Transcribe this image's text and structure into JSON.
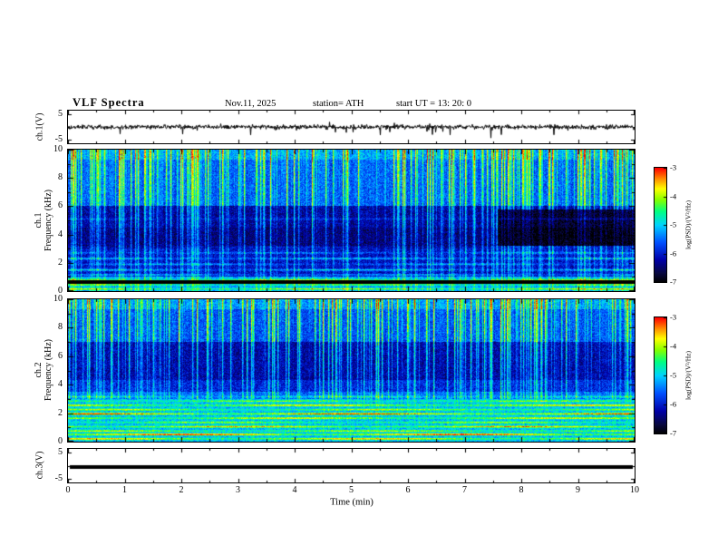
{
  "header": {
    "title": "VLF  Spectra",
    "date": "Nov.11, 2025",
    "station": "station= ATH",
    "start_ut": "start UT  =   13: 20: 0"
  },
  "axes": {
    "time_title": "Time  (min)",
    "time_ticks": [
      0,
      1,
      2,
      3,
      4,
      5,
      6,
      7,
      8,
      9,
      10
    ],
    "ch1v": {
      "label": "ch.1(V)",
      "ticks": [
        5,
        -5
      ]
    },
    "ch3v": {
      "label": "ch.3(V)",
      "ticks": [
        5,
        -5
      ]
    },
    "ch1f": {
      "line1": "ch.1",
      "line2": "Frequency  (kHz)",
      "ticks": [
        10,
        8,
        6,
        4,
        2,
        0
      ]
    },
    "ch2f": {
      "line1": "ch.2",
      "line2": "Frequency  (kHz)",
      "ticks": [
        10,
        8,
        6,
        4,
        2,
        0
      ]
    }
  },
  "colorbar": {
    "title": "log(PSD)/(V²/Hz)",
    "ticks": [
      -3,
      -4,
      -5,
      -6,
      -7
    ],
    "min": -7,
    "max": -3
  },
  "colors": {
    "background": "#ffffff",
    "axis": "#000000",
    "trace": "#000000",
    "colormap_stops": [
      [
        0.0,
        "#000000"
      ],
      [
        0.08,
        "#08083f"
      ],
      [
        0.2,
        "#0000aa"
      ],
      [
        0.35,
        "#0050ff"
      ],
      [
        0.5,
        "#00d2ff"
      ],
      [
        0.62,
        "#00ff82"
      ],
      [
        0.72,
        "#82ff00"
      ],
      [
        0.82,
        "#ffff00"
      ],
      [
        0.9,
        "#ff9600"
      ],
      [
        1.0,
        "#ff0000"
      ]
    ]
  },
  "chart_data": [
    {
      "type": "line",
      "name": "ch1-voltage-waveform",
      "panel": "p1",
      "ylabel": "ch.1(V)",
      "ylim": [
        -5,
        5
      ],
      "yticks": [
        5,
        -5
      ],
      "x_range_min": [
        0,
        10
      ],
      "description": "Channel 1 VLF receiver voltage vs time: broadband noise around 0 V (about +/-1.5 V) with frequent impulsive sferic spikes reaching about -5 V",
      "noise_sigma": 0.55,
      "spike_rate": 0.025,
      "seed": 101
    },
    {
      "type": "heatmap",
      "name": "ch1-spectrogram",
      "panel": "p2",
      "x_range_min": [
        0,
        10
      ],
      "y_range_khz": [
        0,
        10
      ],
      "value_range_log_psd": [
        -7,
        -3
      ],
      "description": "Channel 1 VLF spectrogram: dense vertical sferic streaks 0-10 kHz, bright yellow-green band above ~6 kHz, dark blue quiet band 3-6 kHz, horizontal interference lines below 3 kHz, black band near 0.5-0.8 kHz; the 3.2-5.8 kHz band darkens after ~7.6 min",
      "seed": 202,
      "noise": 0.75,
      "streak_rate": 0.27,
      "streak_max": 2.4,
      "streak_floor": 0.32,
      "bands": [
        {
          "lo": 9.3,
          "hi": 10.01,
          "level": -5.35
        },
        {
          "lo": 6.0,
          "hi": 9.3,
          "level": -5.65
        },
        {
          "lo": 4.5,
          "hi": 6.0,
          "level": -6.35
        },
        {
          "lo": 3.0,
          "hi": 4.5,
          "level": -6.5
        },
        {
          "lo": 1.0,
          "hi": 3.0,
          "level": -6.15
        },
        {
          "lo": -0.1,
          "hi": 1.0,
          "level": -5.3
        }
      ],
      "lines": [
        {
          "f": 0.15,
          "s": 1.2
        },
        {
          "f": 0.45,
          "s": 0.9
        },
        {
          "f": 0.8,
          "s": 1.0
        },
        {
          "f": 1.15,
          "s": 0.8
        },
        {
          "f": 1.5,
          "s": 1.0
        },
        {
          "f": 1.9,
          "s": 0.7
        },
        {
          "f": 2.3,
          "s": 0.9
        },
        {
          "f": 2.7,
          "s": 0.6
        },
        {
          "f": 3.1,
          "s": 0.5
        },
        {
          "f": 5.1,
          "s": 0.4
        }
      ],
      "black_bands": [
        [
          0.5,
          0.8
        ]
      ],
      "mode_change": {
        "t": 7.58,
        "f_lo": 3.2,
        "f_hi": 5.8,
        "delta": -0.55,
        "streak_factor": 0.45
      }
    },
    {
      "type": "heatmap",
      "name": "ch2-spectrogram",
      "panel": "p3",
      "x_range_min": [
        0,
        10
      ],
      "y_range_khz": [
        0,
        10
      ],
      "value_range_log_psd": [
        -7,
        -3
      ],
      "description": "Channel 2 VLF spectrogram: sferic streaks above ~4 kHz over dark blue background, strong green-yellow-orange-red horizontal interference striations below ~3.5 kHz persisting the full 10 minutes",
      "seed": 303,
      "noise": 0.75,
      "streak_rate": 0.28,
      "streak_max": 2.4,
      "streak_floor": 0.3,
      "low_streak_cut": 3.0,
      "bands": [
        {
          "lo": 9.3,
          "hi": 10.01,
          "level": -5.4
        },
        {
          "lo": 7.0,
          "hi": 9.3,
          "level": -5.75
        },
        {
          "lo": 4.3,
          "hi": 7.0,
          "level": -6.3
        },
        {
          "lo": 3.5,
          "hi": 4.3,
          "level": -6.0
        },
        {
          "lo": 3.0,
          "hi": 3.5,
          "level": -5.6
        },
        {
          "lo": -0.1,
          "hi": 3.0,
          "level": -5.15
        }
      ],
      "lines": [
        {
          "f": 0.2,
          "s": 1.5
        },
        {
          "f": 0.5,
          "s": 2.0
        },
        {
          "f": 0.75,
          "s": 1.1
        },
        {
          "f": 1.05,
          "s": 1.5
        },
        {
          "f": 1.35,
          "s": 1.0
        },
        {
          "f": 1.65,
          "s": 1.3
        },
        {
          "f": 1.95,
          "s": 1.9
        },
        {
          "f": 2.25,
          "s": 1.1
        },
        {
          "f": 2.55,
          "s": 1.4
        },
        {
          "f": 2.85,
          "s": 0.9
        },
        {
          "f": 3.15,
          "s": 0.7
        }
      ]
    },
    {
      "type": "line",
      "name": "ch3-voltage-waveform",
      "panel": "p4",
      "ylabel": "ch.3(V)",
      "ylim": [
        -5,
        5
      ],
      "yticks": [
        5,
        -5
      ],
      "x_range_min": [
        0,
        10
      ],
      "description": "Channel 3 voltage vs time: flat constant thick trace near -0.5 V (no signal)",
      "constant_value": -0.5,
      "seed": 404
    }
  ]
}
